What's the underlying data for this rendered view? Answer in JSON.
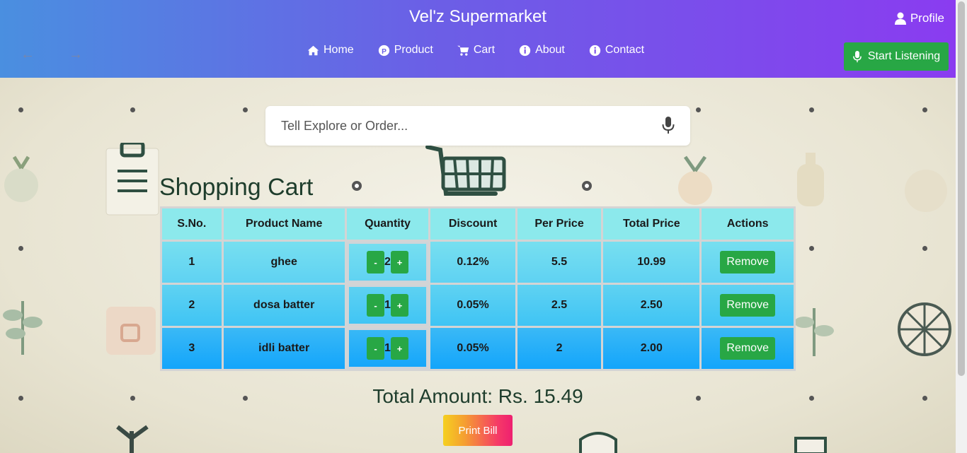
{
  "header": {
    "title": "Vel'z Supermarket",
    "profile_label": "Profile",
    "listen_label": "Start Listening",
    "nav": [
      {
        "label": "Home",
        "icon": "home-icon"
      },
      {
        "label": "Product",
        "icon": "product-icon"
      },
      {
        "label": "Cart",
        "icon": "cart-icon"
      },
      {
        "label": "About",
        "icon": "info-icon"
      },
      {
        "label": "Contact",
        "icon": "info-icon"
      }
    ]
  },
  "search": {
    "placeholder": "Tell Explore or Order..."
  },
  "cart": {
    "title": "Shopping Cart",
    "columns": [
      "S.No.",
      "Product Name",
      "Quantity",
      "Discount",
      "Per Price",
      "Total Price",
      "Actions"
    ],
    "rows": [
      {
        "sno": "1",
        "name": "ghee",
        "qty": "2",
        "discount": "0.12%",
        "per_price": "5.5",
        "total": "10.99",
        "action": "Remove"
      },
      {
        "sno": "2",
        "name": "dosa batter",
        "qty": "1",
        "discount": "0.05%",
        "per_price": "2.5",
        "total": "2.50",
        "action": "Remove"
      },
      {
        "sno": "3",
        "name": "idli batter",
        "qty": "1",
        "discount": "0.05%",
        "per_price": "2",
        "total": "2.00",
        "action": "Remove"
      }
    ],
    "minus": "-",
    "plus": "+",
    "total_amount": "Total Amount: Rs. 15.49",
    "print_label": "Print Bill"
  },
  "colors": {
    "header_start": "#4a8fe0",
    "header_end": "#8a3cf0",
    "button_green": "#28a745"
  }
}
